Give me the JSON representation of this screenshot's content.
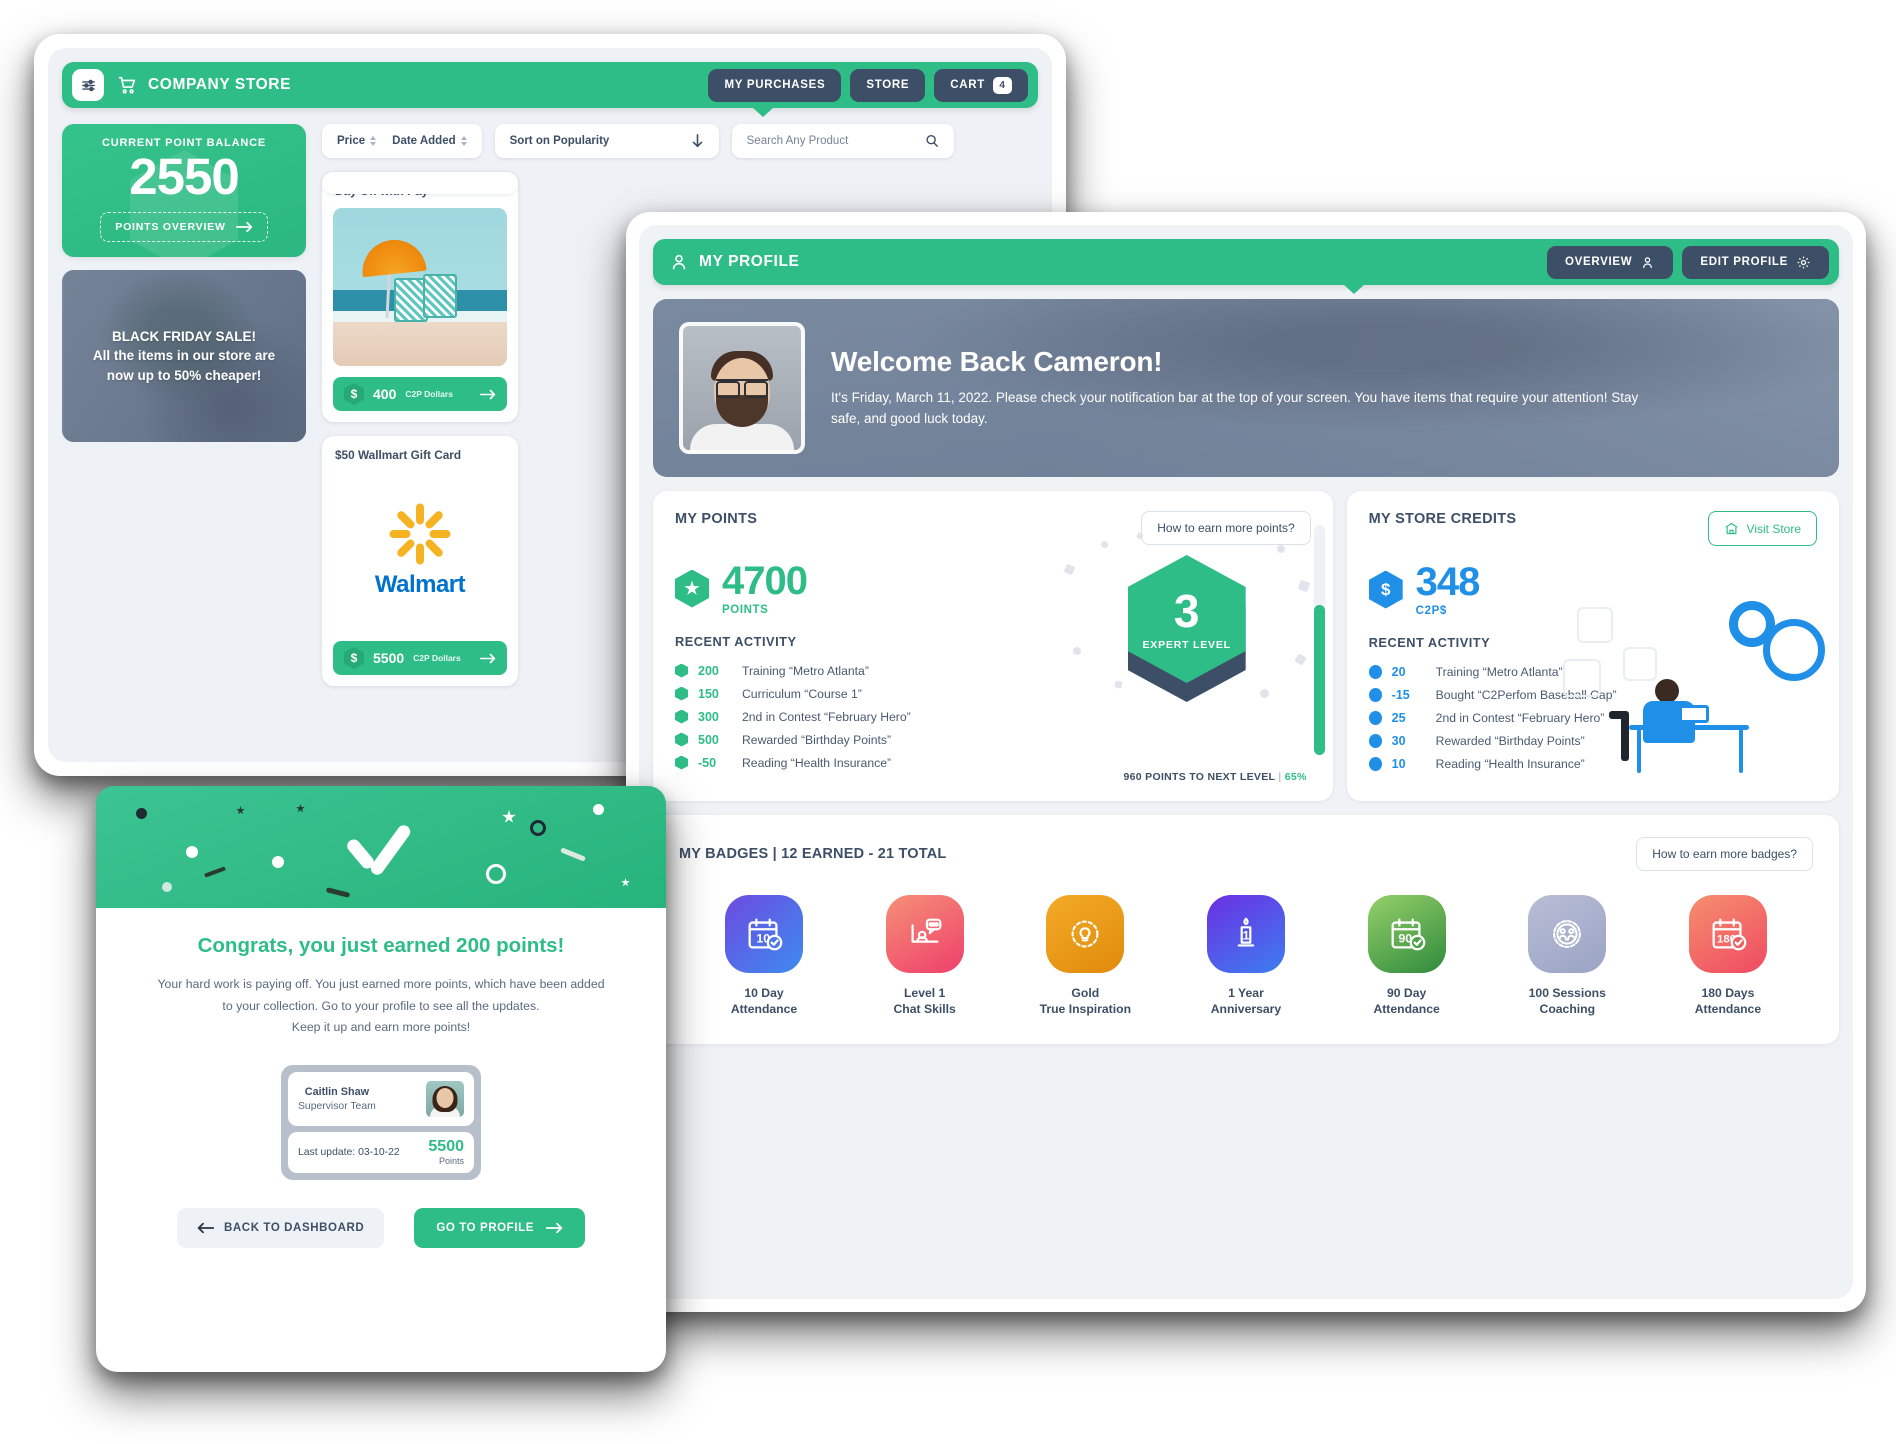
{
  "store": {
    "header": {
      "title": "COMPANY STORE",
      "settings_icon": "sliders-icon",
      "cart_icon": "cart-icon",
      "buttons": [
        {
          "label": "MY PURCHASES",
          "badge": null
        },
        {
          "label": "STORE",
          "badge": null
        },
        {
          "label": "CART",
          "badge": "4"
        }
      ]
    },
    "balance": {
      "label": "CURRENT POINT BALANCE",
      "value": "2550",
      "cta": "POINTS OVERVIEW"
    },
    "promo": {
      "line1": "BLACK FRIDAY SALE!",
      "line2": "All the items in our store are",
      "line3": "now up to 50% cheaper!"
    },
    "filters": {
      "price": "Price",
      "date_added": "Date Added",
      "sort": "Sort on Popularity",
      "search_placeholder": "Search Any Product"
    },
    "products": [
      {
        "name": "Day Off with Pay",
        "price": "400",
        "currency": "C2P Dollars",
        "image": "beach-umbrella-photo"
      },
      {
        "name": "$50 Wallmart Gift Card",
        "price": "5500",
        "currency": "C2P Dollars",
        "image": "walmart-logo"
      }
    ]
  },
  "profile": {
    "header": {
      "title": "MY PROFILE",
      "user_icon": "user-icon",
      "buttons": [
        {
          "label": "OVERVIEW",
          "icon": "user-icon"
        },
        {
          "label": "EDIT PROFILE",
          "icon": "gear-icon"
        }
      ]
    },
    "welcome": {
      "title": "Welcome Back Cameron!",
      "line1": "It's Friday, March 11, 2022. Please check your notification bar at the top of your screen. You have items that require",
      "line2": "your attention! Stay safe, and good luck today."
    },
    "points": {
      "title": "MY POINTS",
      "help_button": "How to earn more points?",
      "value": "4700",
      "unit": "POINTS",
      "activity_title": "RECENT ACTIVITY",
      "activity": [
        {
          "amount": "200",
          "label": "Training “Metro Atlanta”"
        },
        {
          "amount": "150",
          "label": "Curriculum “Course 1”"
        },
        {
          "amount": "300",
          "label": "2nd in Contest “February Hero”"
        },
        {
          "amount": "500",
          "label": "Rewarded “Birthday Points”"
        },
        {
          "amount": "-50",
          "label": "Reading “Health Insurance”"
        }
      ],
      "level_number": "3",
      "level_label": "EXPERT LEVEL",
      "next_level_text": "960 POINTS TO NEXT LEVEL",
      "next_level_pct": "65%"
    },
    "credits": {
      "title": "MY STORE CREDITS",
      "visit_button": "Visit Store",
      "visit_icon": "store-icon",
      "value": "348",
      "unit": "C2P$",
      "activity_title": "RECENT ACTIVITY",
      "activity": [
        {
          "amount": "20",
          "label": "Training “Metro Atlanta”"
        },
        {
          "amount": "-15",
          "label": "Bought “C2Perfom Baseball Cap”"
        },
        {
          "amount": "25",
          "label": "2nd in Contest “February Hero”"
        },
        {
          "amount": "30",
          "label": "Rewarded “Birthday Points”"
        },
        {
          "amount": "10",
          "label": "Reading “Health Insurance”"
        }
      ]
    },
    "badges": {
      "title": "MY BADGES | 12 EARNED - 21 TOTAL",
      "help_button": "How to earn more badges?",
      "items": [
        {
          "line1": "10 Day",
          "line2": "Attendance",
          "icon": "calendar-10-check-icon",
          "color_from": "#6d4ae0",
          "color_to": "#3d8bf0"
        },
        {
          "line1": "Level 1",
          "line2": "Chat Skills",
          "icon": "chat-presentation-icon",
          "color_from": "#f59078",
          "color_to": "#ef3f6a"
        },
        {
          "line1": "Gold",
          "line2": "True Inspiration",
          "icon": "lightbulb-laurel-icon",
          "color_from": "#f3ab26",
          "color_to": "#e08a0c"
        },
        {
          "line1": "1 Year",
          "line2": "Anniversary",
          "icon": "birthday-candle-icon",
          "color_from": "#6b2fe3",
          "color_to": "#3d7ef0"
        },
        {
          "line1": "90 Day",
          "line2": "Attendance",
          "icon": "calendar-90-check-icon",
          "color_from": "#95d06a",
          "color_to": "#2f8a3c"
        },
        {
          "line1": "100 Sessions",
          "line2": "Coaching",
          "icon": "coaching-rosette-icon",
          "color_from": "#b9bed6",
          "color_to": "#9aa3c4"
        },
        {
          "line1": "180 Days",
          "line2": "Attendance",
          "icon": "calendar-180-check-icon",
          "color_from": "#f68f6e",
          "color_to": "#ef4a62"
        }
      ]
    }
  },
  "modal": {
    "banner_icon": "checkmark-confetti-icon",
    "title": "Congrats, you just earned 200 points!",
    "desc_line1": "Your hard work is paying off. You just earned more points, which have been added",
    "desc_line2": "to your collection. Go to your profile to see all the updates.",
    "desc_line3": "Keep it up and earn more points!",
    "user_card": {
      "name": "Caitlin Shaw",
      "role": "Supervisor Team",
      "updated": "Last update: 03-10-22",
      "points": "5500",
      "points_label": "Points"
    },
    "back_button": "BACK TO DASHBOARD",
    "profile_button": "GO TO PROFILE"
  },
  "colors": {
    "green": "#2ebd86",
    "navy": "#3d4f66",
    "blue": "#1f8fe8",
    "page_bg": "#eef1f5"
  }
}
